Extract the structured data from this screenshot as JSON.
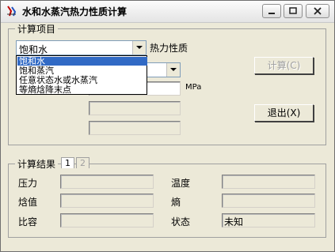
{
  "window": {
    "title": "水和水蒸汽热力性质计算"
  },
  "input_group": {
    "legend": "计算项目",
    "item_select": {
      "value": "饱和水"
    },
    "property_label": "热力性质",
    "unit_label": "MPa",
    "dropdown_options": [
      "饱和水",
      "饱和蒸汽",
      "任意状态水或水蒸汽",
      "等熵焓降末点"
    ],
    "selected_index": 0,
    "calc_button": "计算(C)",
    "exit_button": "退出(X)"
  },
  "result_group": {
    "legend": "计算结果",
    "tabs": [
      "1",
      "2"
    ],
    "labels": {
      "pressure": "压力",
      "temperature": "温度",
      "enthalpy": "焓值",
      "entropy": "熵",
      "specific_volume": "比容",
      "state": "状态"
    },
    "state_value": "未知"
  }
}
